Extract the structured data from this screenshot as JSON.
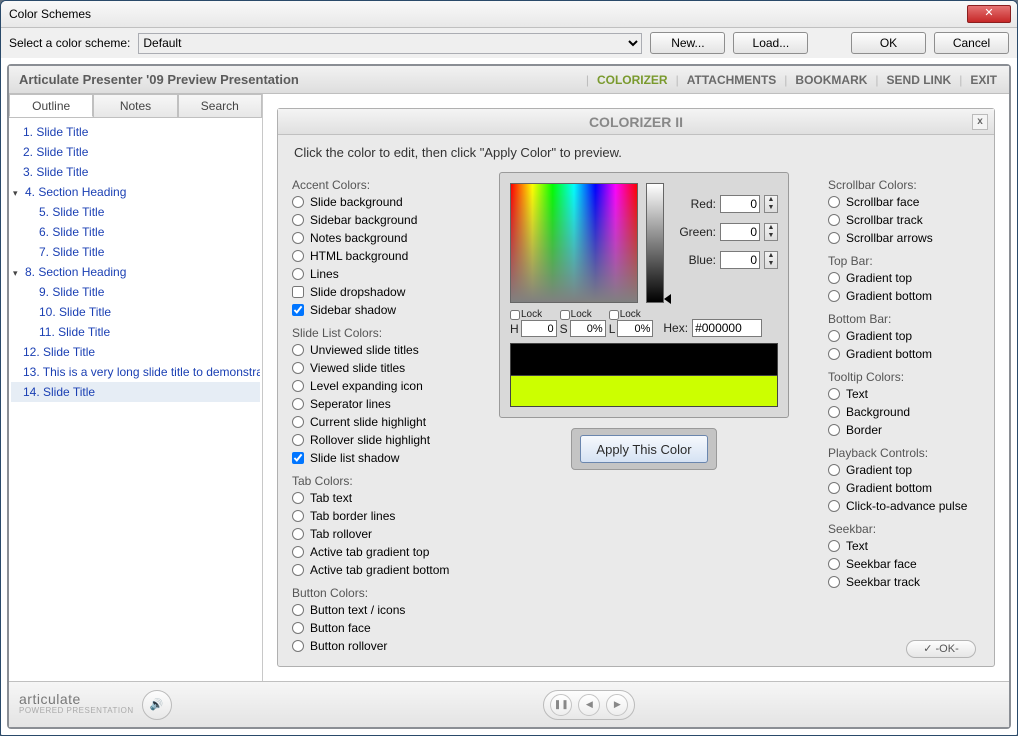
{
  "window": {
    "title": "Color Schemes"
  },
  "toolbar": {
    "label": "Select a color scheme:",
    "selected": "Default",
    "new_btn": "New...",
    "load_btn": "Load...",
    "ok_btn": "OK",
    "cancel_btn": "Cancel"
  },
  "preview": {
    "title": "Articulate Presenter '09 Preview Presentation",
    "links": {
      "colorizer": "COLORIZER",
      "attachments": "ATTACHMENTS",
      "bookmark": "BOOKMARK",
      "sendlink": "SEND LINK",
      "exit": "EXIT"
    }
  },
  "sidebar": {
    "tabs": {
      "outline": "Outline",
      "notes": "Notes",
      "search": "Search"
    },
    "items": [
      {
        "label": "1. Slide Title",
        "type": "item"
      },
      {
        "label": "2. Slide Title",
        "type": "item"
      },
      {
        "label": "3. Slide Title",
        "type": "item"
      },
      {
        "label": "4. Section Heading",
        "type": "heading"
      },
      {
        "label": "5. Slide Title",
        "type": "child"
      },
      {
        "label": "6. Slide Title",
        "type": "child"
      },
      {
        "label": "7. Slide Title",
        "type": "child"
      },
      {
        "label": "8. Section Heading",
        "type": "heading"
      },
      {
        "label": "9. Slide Title",
        "type": "child"
      },
      {
        "label": "10. Slide Title",
        "type": "child"
      },
      {
        "label": "11. Slide Title",
        "type": "child"
      },
      {
        "label": "12. Slide Title",
        "type": "item"
      },
      {
        "label": "13. This is a very long slide title to demonstra",
        "type": "item"
      },
      {
        "label": "14. Slide Title",
        "type": "item",
        "selected": true
      }
    ]
  },
  "colorizer": {
    "title": "COLORIZER II",
    "hint": "Click the color to edit, then click \"Apply Color\" to preview.",
    "groups": {
      "accent": {
        "label": "Accent Colors:",
        "items": [
          "Slide background",
          "Sidebar background",
          "Notes background",
          "HTML background",
          "Lines",
          "Slide dropshadow",
          "Sidebar shadow"
        ]
      },
      "slidelist": {
        "label": "Slide List Colors:",
        "items": [
          "Unviewed slide titles",
          "Viewed slide titles",
          "Level expanding icon",
          "Seperator lines",
          "Current slide highlight",
          "Rollover slide highlight",
          "Slide list shadow"
        ]
      },
      "tab": {
        "label": "Tab Colors:",
        "items": [
          "Tab text",
          "Tab border lines",
          "Tab rollover",
          "Active tab gradient top",
          "Active tab gradient bottom"
        ]
      },
      "button": {
        "label": "Button Colors:",
        "items": [
          "Button text / icons",
          "Button face",
          "Button rollover"
        ]
      },
      "scrollbar": {
        "label": "Scrollbar Colors:",
        "items": [
          "Scrollbar face",
          "Scrollbar track",
          "Scrollbar arrows"
        ]
      },
      "topbar": {
        "label": "Top Bar:",
        "items": [
          "Gradient top",
          "Gradient bottom"
        ]
      },
      "bottombar": {
        "label": "Bottom Bar:",
        "items": [
          "Gradient top",
          "Gradient bottom"
        ]
      },
      "tooltip": {
        "label": "Tooltip Colors:",
        "items": [
          "Text",
          "Background",
          "Border"
        ]
      },
      "playback": {
        "label": "Playback Controls:",
        "items": [
          "Gradient top",
          "Gradient bottom",
          "Click-to-advance pulse"
        ]
      },
      "seekbar": {
        "label": "Seekbar:",
        "items": [
          "Text",
          "Seekbar face",
          "Seekbar track"
        ]
      }
    },
    "rgb": {
      "red_label": "Red:",
      "green_label": "Green:",
      "blue_label": "Blue:",
      "red": "0",
      "green": "0",
      "blue": "0"
    },
    "hsl": {
      "h_label": "H",
      "s_label": "S",
      "l_label": "L",
      "h": "0",
      "s": "0%",
      "l": "0%",
      "lock": "Lock"
    },
    "hex": {
      "label": "Hex:",
      "value": "#000000"
    },
    "apply": "Apply This Color",
    "ok": "✓  -OK-"
  },
  "footer": {
    "brand1": "articulate",
    "brand2": "POWERED PRESENTATION"
  }
}
